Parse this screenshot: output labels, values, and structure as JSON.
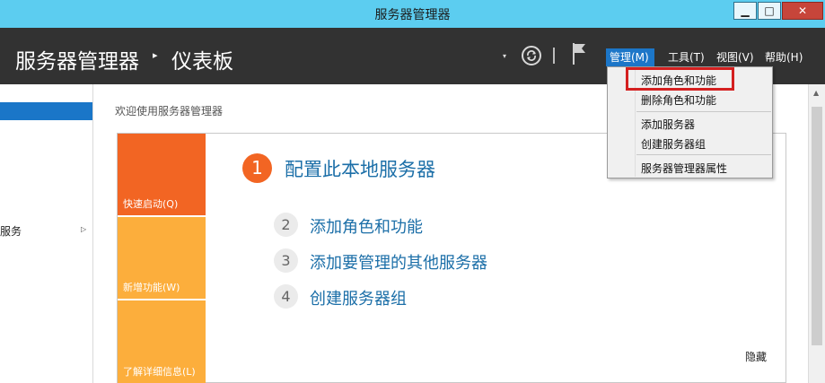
{
  "window": {
    "title": "服务器管理器",
    "minimize_glyph": "▁",
    "maximize_glyph": "□",
    "close_glyph": "✕"
  },
  "header": {
    "breadcrumb_root": "服务器管理器",
    "breadcrumb_separator": "▸",
    "breadcrumb_current": "仪表板",
    "dropdown_glyph": "▾",
    "menus": {
      "manage": "管理(M)",
      "tools": "工具(T)",
      "view": "视图(V)",
      "help": "帮助(H)"
    }
  },
  "sidebar": {
    "item_label": "服务",
    "item_arrow": "▷"
  },
  "main": {
    "welcome_title": "欢迎使用服务器管理器",
    "tiles": {
      "quick_start": "快速启动(Q)",
      "whats_new": "新增功能(W)",
      "learn_more": "了解详细信息(L)"
    },
    "steps": [
      {
        "number": "1",
        "label": "配置此本地服务器"
      },
      {
        "number": "2",
        "label": "添加角色和功能"
      },
      {
        "number": "3",
        "label": "添加要管理的其他服务器"
      },
      {
        "number": "4",
        "label": "创建服务器组"
      }
    ],
    "hide_label": "隐藏"
  },
  "manage_menu": {
    "items": [
      "添加角色和功能",
      "删除角色和功能",
      "添加服务器",
      "创建服务器组",
      "服务器管理器属性"
    ]
  },
  "colors": {
    "titlebar": "#5ccdf0",
    "header": "#323232",
    "accent_blue": "#1c76c8",
    "tile_orange": "#f26523",
    "tile_amber": "#fcae3c",
    "highlight_red": "#d42020"
  }
}
